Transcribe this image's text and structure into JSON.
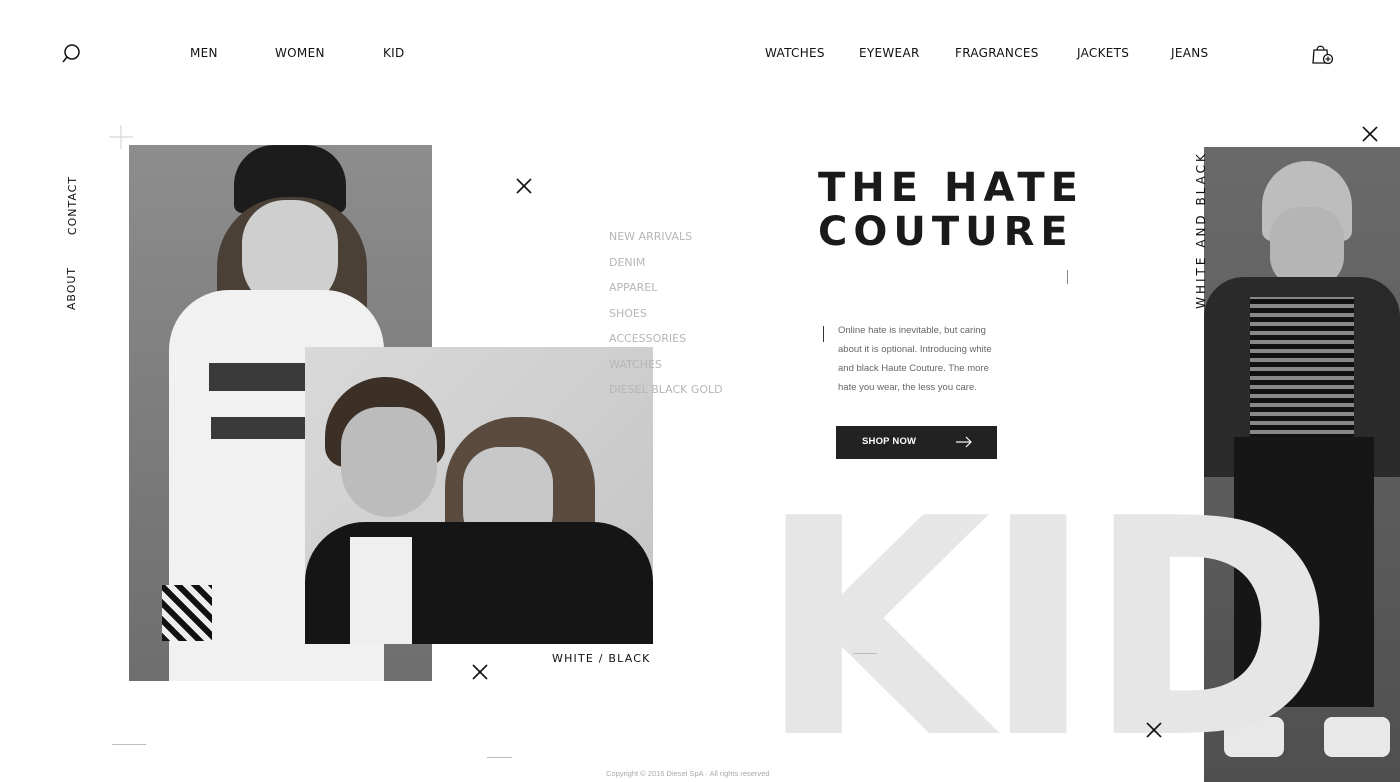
{
  "header": {
    "nav_left": [
      "MEN",
      "WOMEN",
      "KID"
    ],
    "nav_right": [
      "WATCHES",
      "EYEWEAR",
      "FRAGRANCES",
      "JACKETS",
      "JEANS"
    ],
    "search_icon": "search-icon",
    "cart_icon": "shopping-bag-icon"
  },
  "sidebar": {
    "links": [
      "CONTACT",
      "ABOUT"
    ]
  },
  "categories": [
    "NEW ARRIVALS",
    "DENIM",
    "APPAREL",
    "SHOES",
    "ACCESSORIES",
    "WATCHES",
    "DIESEL BLACK GOLD"
  ],
  "hero": {
    "title_line1": "THE HATE",
    "title_line2": "COUTURE",
    "description": "Online hate is inevitable, but caring about it is optional. Introducing white and black Haute Couture. The more hate you wear, the less you care.",
    "cta_label": "SHOP NOW",
    "big_text": "KID",
    "caption": "WHITE / BLACK",
    "side_title": "WHITE AND BLACK"
  },
  "footer": {
    "copyright": "Copyright © 2016 Diesel SpA · All rights reserved"
  },
  "colors": {
    "text": "#111111",
    "button_bg": "#222222",
    "big_text": "#e6e6e6",
    "muted": "#b6b6b6"
  }
}
